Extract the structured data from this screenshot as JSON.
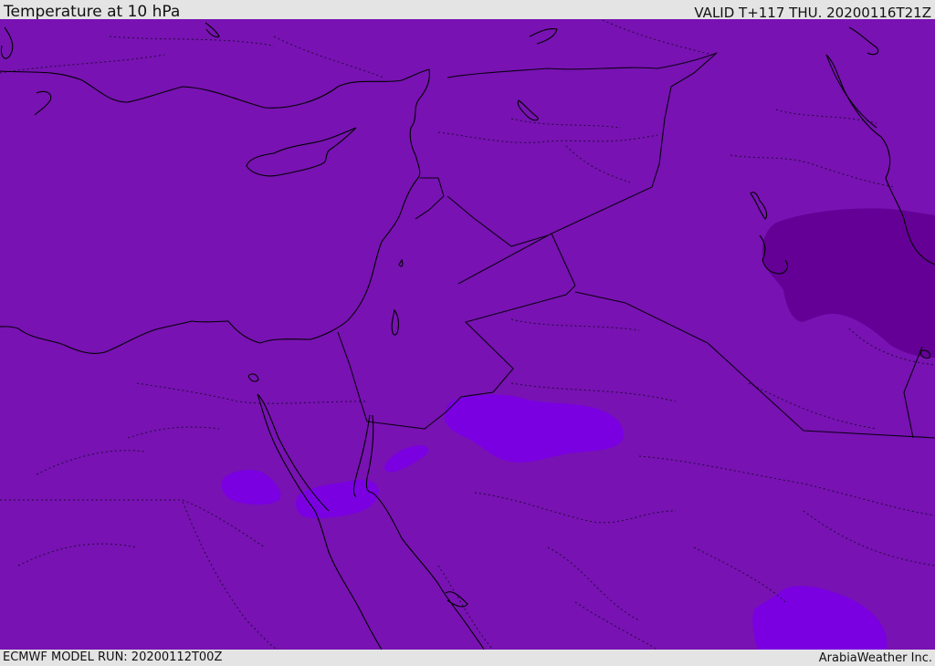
{
  "header": {
    "title": "Temperature at 10 hPa",
    "valid": "VALID T+117 THU. 20200116T21Z"
  },
  "footer": {
    "model_run": "ECMWF MODEL RUN: 20200112T00Z",
    "credit": "ArabiaWeather Inc."
  },
  "map": {
    "region": "Eastern Mediterranean / Middle East",
    "colors": {
      "base_field": "#7812b2",
      "cold_field": "#640096",
      "warm_field": "#7a00e2",
      "coastline": "#000000",
      "border": "#1a0a30"
    }
  }
}
